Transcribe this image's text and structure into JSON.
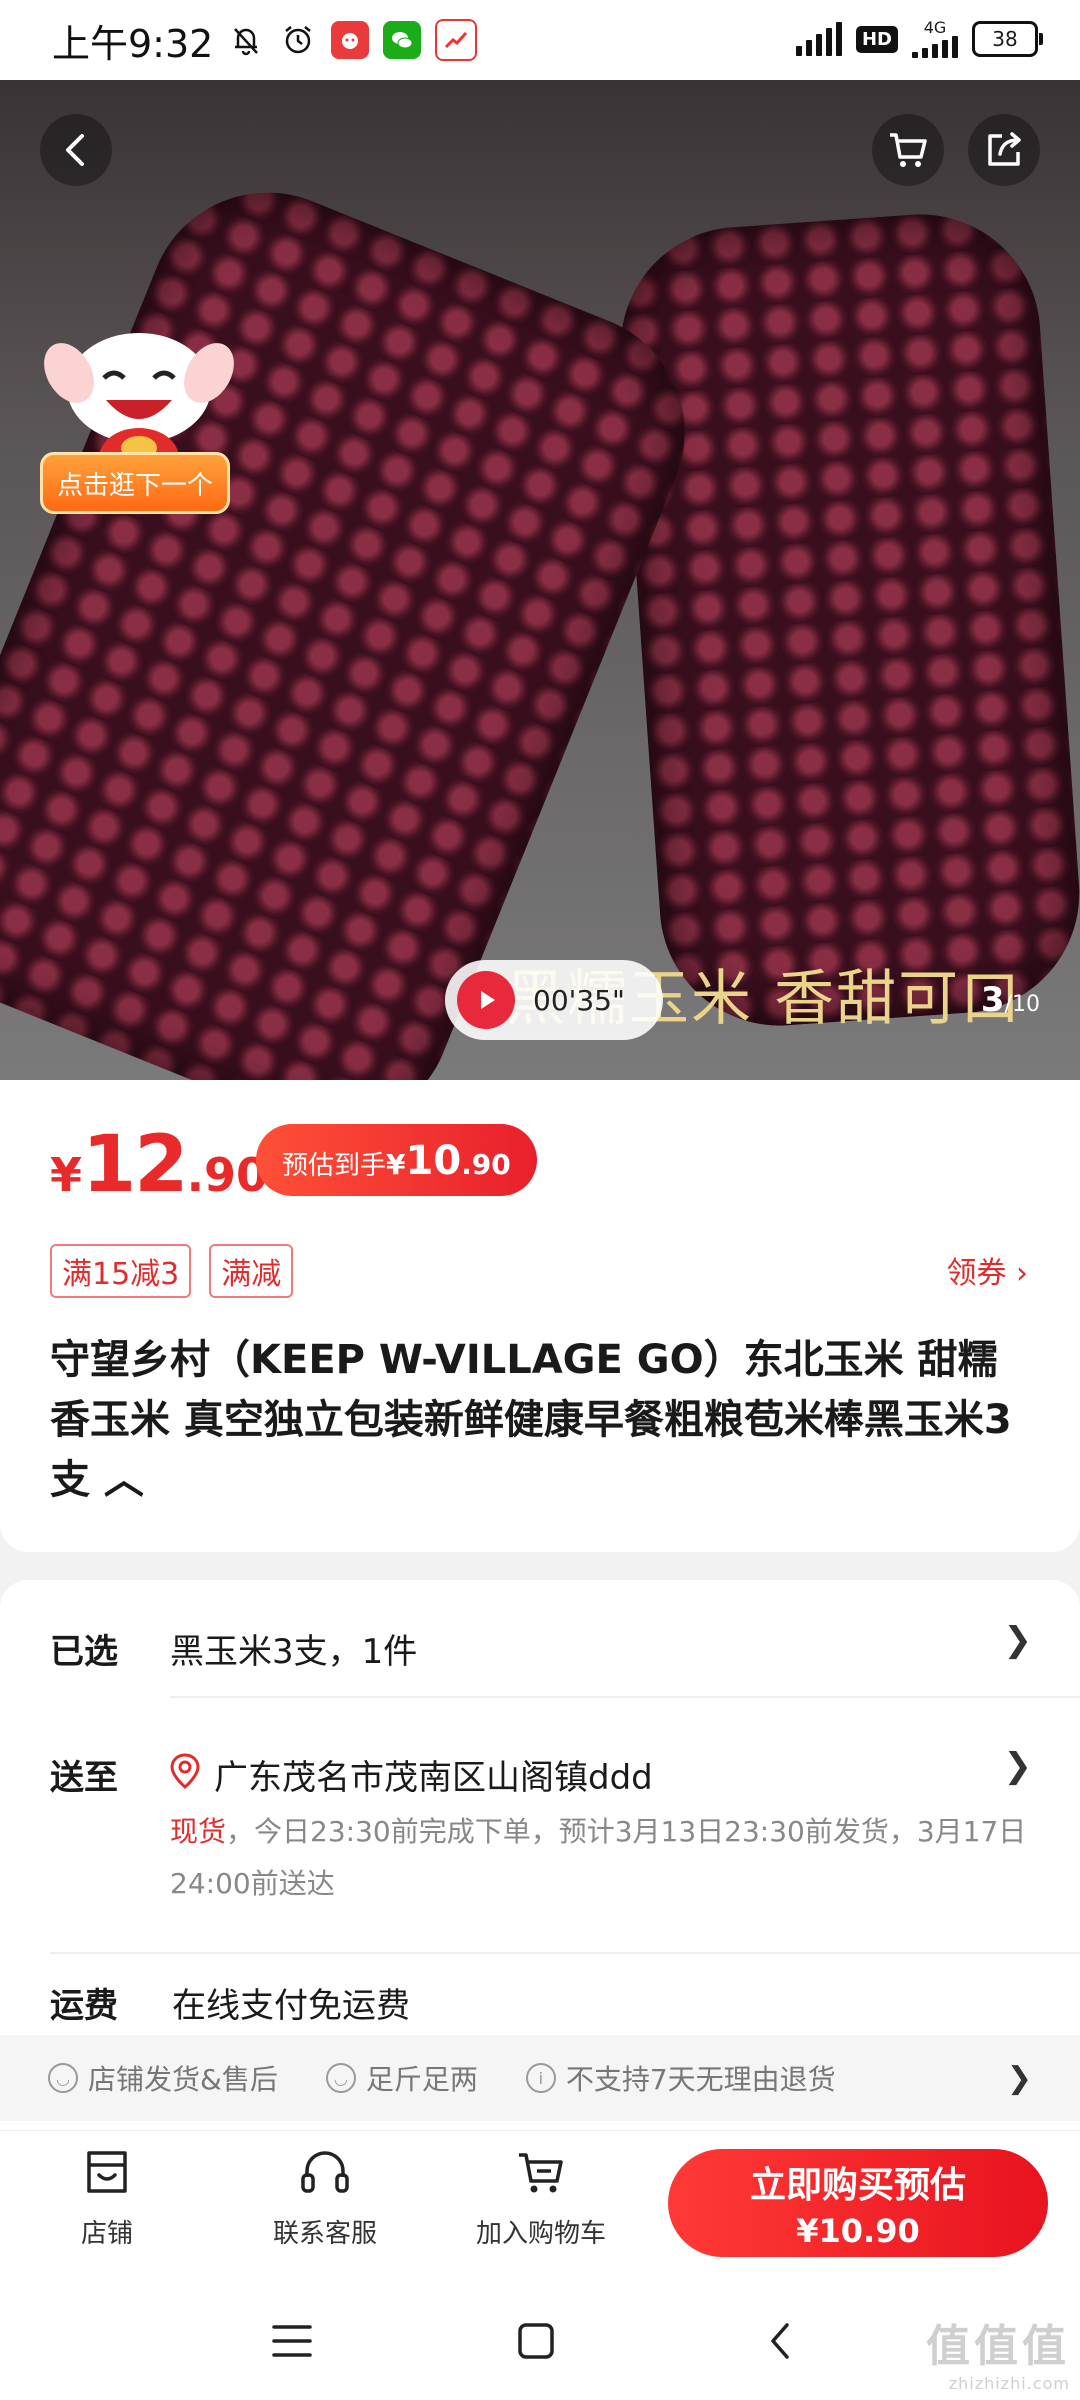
{
  "status_bar": {
    "time": "上午9:32",
    "network": "4G",
    "hd_label": "HD",
    "battery": "38"
  },
  "hero": {
    "video_duration": "00'35\"",
    "caption": "黑糯玉米 香甜可口",
    "page_current": "3",
    "page_total": "/10",
    "next_label": "点击逛下一个"
  },
  "price": {
    "currency": "¥",
    "integer": "12",
    "decimal": ".90",
    "estimate_label": "预估到手",
    "estimate_currency": "¥",
    "estimate_integer": "10",
    "estimate_decimal": ".90"
  },
  "promotions": {
    "tags": [
      "满15减3",
      "满减"
    ],
    "coupon_label": "领券 ›"
  },
  "product": {
    "title": "守望乡村（KEEP W-VILLAGE GO）东北玉米 甜糯香玉米 真空独立包装新鲜健康早餐粗粮苞米棒黑玉米3支 ︿"
  },
  "details": {
    "selected_label": "已选",
    "selected_value": "黑玉米3支，1件",
    "ship_label": "送至",
    "ship_address": "广东茂名市茂南区山阁镇ddd",
    "stock_status": "现货",
    "delivery_note": "，今日23:30前完成下单，预计3月13日23:30前发货，3月17日24:00前送达",
    "fee_label": "运费",
    "fee_value": "在线支付免运费",
    "services": [
      "店铺发货&售后",
      "足斤足两",
      "不支持7天无理由退货"
    ]
  },
  "bottom_bar": {
    "store": "店铺",
    "service": "联系客服",
    "add_cart": "加入购物车",
    "buy_line1": "立即购买预估",
    "buy_line2": "¥10.90"
  },
  "watermark": {
    "text": "值值值",
    "site": "zhizhizhi.com"
  },
  "colors": {
    "accent": "#e82a2a",
    "buy_button": "#e8131f",
    "next_pill": "#ff7a1a"
  }
}
